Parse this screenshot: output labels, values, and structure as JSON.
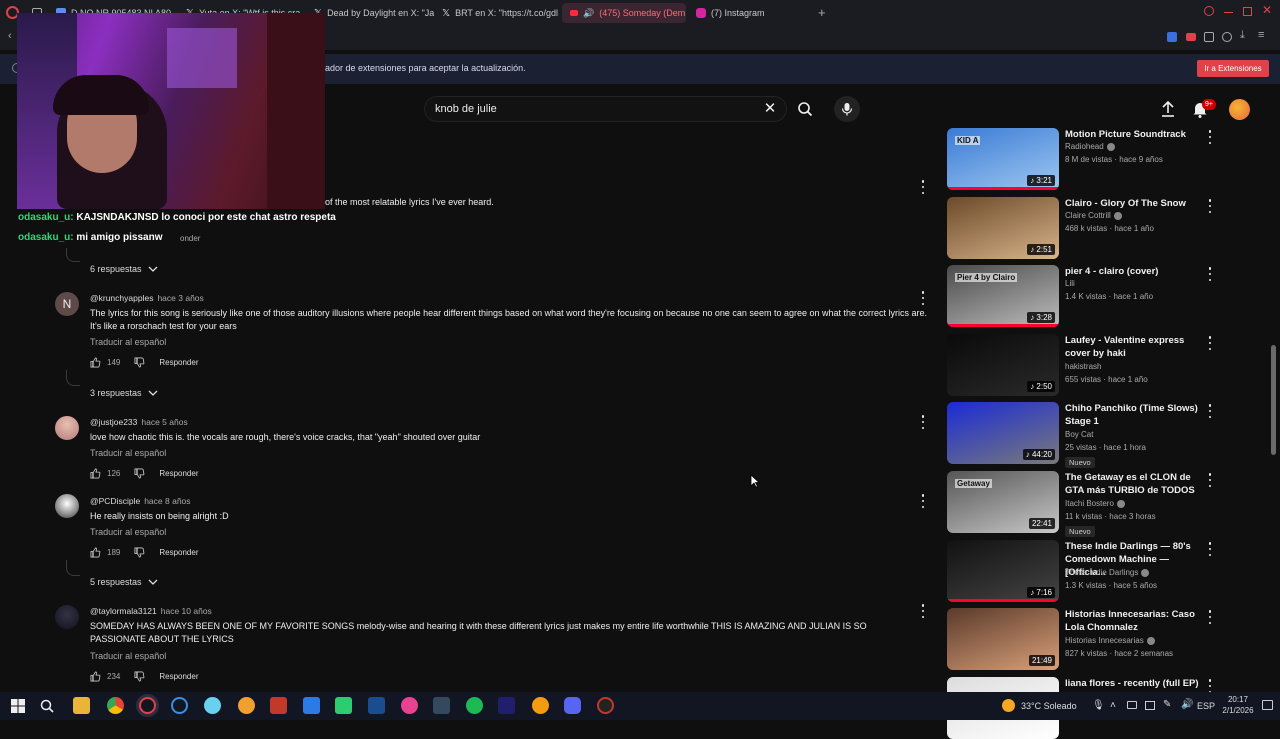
{
  "browser": {
    "tabs": [
      {
        "label": "D NO NR 905483 NI A80",
        "color": "#5a8dee"
      },
      {
        "label": "Yuta en X: \"Wtf is this cra",
        "color": "#777"
      },
      {
        "label": "Dead by Daylight en X: \"Ja",
        "color": "#777"
      },
      {
        "label": "BRT en X: \"https://t.co/gdl",
        "color": "#777"
      },
      {
        "label": "(475) Someday (Dem",
        "color": "#ff2b3a"
      },
      {
        "label": "(7) Instagram",
        "color": "#d6249f"
      }
    ],
    "new_tab": "+",
    "notice_text": "ador de extensiones para aceptar la actualización.",
    "notice_button": "Ir a Extensiones"
  },
  "header": {
    "search_value": "knob de julie",
    "clear": "✕",
    "notif_count": "9+"
  },
  "chat": [
    {
      "user": "odasaku_u:",
      "text": "KAJSNDAKJNSD lo conoci por este chat astro respeta"
    },
    {
      "user": "odasaku_u:",
      "text": "mi amigo pissanw"
    }
  ],
  "comments_top": {
    "text_tail": "of the most relatable lyrics I've ever heard.",
    "reply_label": "onder",
    "replies": "6 respuestas"
  },
  "comments": [
    {
      "avatar_letter": "N",
      "avatar_color": "#5f4a4a",
      "author": "@krunchyapples",
      "when": "hace 3 años",
      "text": "The lyrics for this song is seriously like one of those auditory illusions where people hear different things based on what word they're focusing on because no one can seem to agree on what the correct lyrics are. It's like a rorschach test for your ears",
      "translate": "Traducir al español",
      "likes": "149",
      "reply": "Responder",
      "replies": "3 respuestas"
    },
    {
      "avatar_letter": "",
      "avatar_color": "#c99",
      "author": "@justjoe233",
      "when": "hace 5 años",
      "text": "love how chaotic this is. the vocals are rough, there's voice cracks, that \"yeah\" shouted over guitar",
      "translate": "Traducir al español",
      "likes": "126",
      "reply": "Responder",
      "replies": ""
    },
    {
      "avatar_letter": "",
      "avatar_color": "#bbb",
      "author": "@PCDisciple",
      "when": "hace 8 años",
      "text": "He really insists on being alright :D",
      "translate": "Traducir al español",
      "likes": "189",
      "reply": "Responder",
      "replies": "5 respuestas"
    },
    {
      "avatar_letter": "",
      "avatar_color": "#445",
      "author": "@taylormala3121",
      "when": "hace 10 años",
      "text": "SOMEDAY HAS ALWAYS BEEN ONE OF MY FAVORITE SONGS melody-wise and hearing it with these different lyrics just makes my entire life worthwhile THIS IS AMAZING AND JULIAN IS SO PASSIONATE ABOUT THE LYRICS",
      "translate": "Traducir al español",
      "likes": "234",
      "reply": "Responder",
      "replies": ""
    }
  ],
  "sidebar": [
    {
      "title": "Motion Picture Soundtrack",
      "channel": "Radiohead",
      "verified": true,
      "meta": "8 M de vistas · hace 9 años",
      "duration": "♪ 3:21",
      "badge": "",
      "thumb_label": "KID A",
      "thumb": [
        "#3a7bd5",
        "#9ec7f0"
      ],
      "progress": true
    },
    {
      "title": "Clairo - Glory Of The Snow",
      "channel": "Claire Cottrill",
      "verified": true,
      "meta": "468 k vistas · hace 1 año",
      "duration": "♪ 2:51",
      "badge": "",
      "thumb_label": "",
      "thumb": [
        "#6b4a2a",
        "#d9b48a"
      ],
      "progress": false
    },
    {
      "title": "pier 4 - clairo (cover)",
      "channel": "Lili",
      "verified": false,
      "meta": "1.4 K vistas · hace 1 año",
      "duration": "♪ 3:28",
      "badge": "",
      "thumb_label": "Pier 4 by Clairo",
      "thumb": [
        "#4a4a4a",
        "#bdbdbd"
      ],
      "progress": true
    },
    {
      "title": "Laufey - Valentine express cover by haki",
      "channel": "hakistrash",
      "verified": false,
      "meta": "655 vistas · hace 1 año",
      "duration": "♪ 2:50",
      "badge": "",
      "thumb_label": "",
      "thumb": [
        "#0a0a0a",
        "#2a2a2a"
      ],
      "progress": false
    },
    {
      "title": "Chiho Panchiko (Time Slows) Stage 1",
      "channel": "Boy Cat",
      "verified": false,
      "meta": "25 vistas · hace 1 hora",
      "duration": "♪ 44:20",
      "badge": "Nuevo",
      "thumb_label": "",
      "thumb": [
        "#1a2bd6",
        "#7a7a7a"
      ],
      "progress": false
    },
    {
      "title": "The Getaway es el CLON de GTA más TURBIO de TODOS",
      "channel": "Itachi Bostero",
      "verified": true,
      "meta": "11 k vistas · hace 3 horas",
      "duration": "22:41",
      "badge": "Nuevo",
      "thumb_label": "Getaway",
      "thumb": [
        "#555",
        "#c8c8c8"
      ],
      "progress": false
    },
    {
      "title": "These Indie Darlings — 80's Comedown Machine — [Officia...",
      "channel": "These Indie Darlings",
      "verified": true,
      "meta": "1.3 K vistas · hace 5 años",
      "duration": "♪ 7:16",
      "badge": "",
      "thumb_label": "",
      "thumb": [
        "#111",
        "#444"
      ],
      "progress": true
    },
    {
      "title": "Historias Innecesarias: Caso Lola Chomnalez",
      "channel": "Historias Innecesarias",
      "verified": true,
      "meta": "827 k vistas · hace 2 semanas",
      "duration": "21:49",
      "badge": "",
      "thumb_label": "",
      "thumb": [
        "#5a3a2a",
        "#d9a07a"
      ],
      "progress": false
    },
    {
      "title": "liana flores - recently (full EP)",
      "channel": "",
      "verified": false,
      "meta": "",
      "duration": "",
      "badge": "",
      "thumb_label": "",
      "thumb": [
        "#ddd",
        "#fff"
      ],
      "progress": false
    }
  ],
  "taskbar": {
    "weather": "33°C  Soleado",
    "lang": "ESP",
    "time": "20:17",
    "date": "2/1/2026"
  },
  "colors": {
    "accent": "#ff0033",
    "chat_user": "#2bd97a",
    "notice_bg": "#1c2033"
  }
}
